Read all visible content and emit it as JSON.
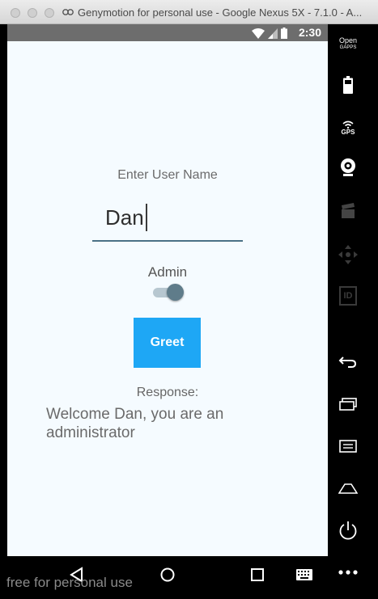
{
  "window": {
    "title": "Genymotion for personal use - Google Nexus 5X - 7.1.0 - A..."
  },
  "statusbar": {
    "time": "2:30"
  },
  "app": {
    "user_label": "Enter User Name",
    "username_value": "Dan",
    "admin_label": "Admin",
    "admin_enabled": true,
    "greet_button": "Greet",
    "response_label": "Response:",
    "response_text": "Welcome Dan, you are an administrator"
  },
  "sidebar": {
    "opengapps_line1": "Open",
    "opengapps_line2": "GAPPS",
    "gps_label": "GPS",
    "id_label": "ID",
    "items": [
      "opengapps-icon",
      "battery-icon",
      "gps-icon",
      "webcam-icon",
      "media-clapper-icon",
      "dpad-icon",
      "id-icon",
      "back-icon",
      "recent-apps-icon",
      "menu-icon",
      "home-icon",
      "power-icon",
      "more-icon"
    ]
  },
  "navbar": {
    "icons": [
      "back-triangle-icon",
      "home-circle-icon",
      "recents-square-icon",
      "keyboard-icon"
    ]
  },
  "watermark": "free for personal use",
  "colors": {
    "accent_button": "#1ea7f5",
    "screen_bg": "#f5fbff",
    "switch_thumb": "#5f7c8a",
    "input_underline": "#4a7186"
  }
}
